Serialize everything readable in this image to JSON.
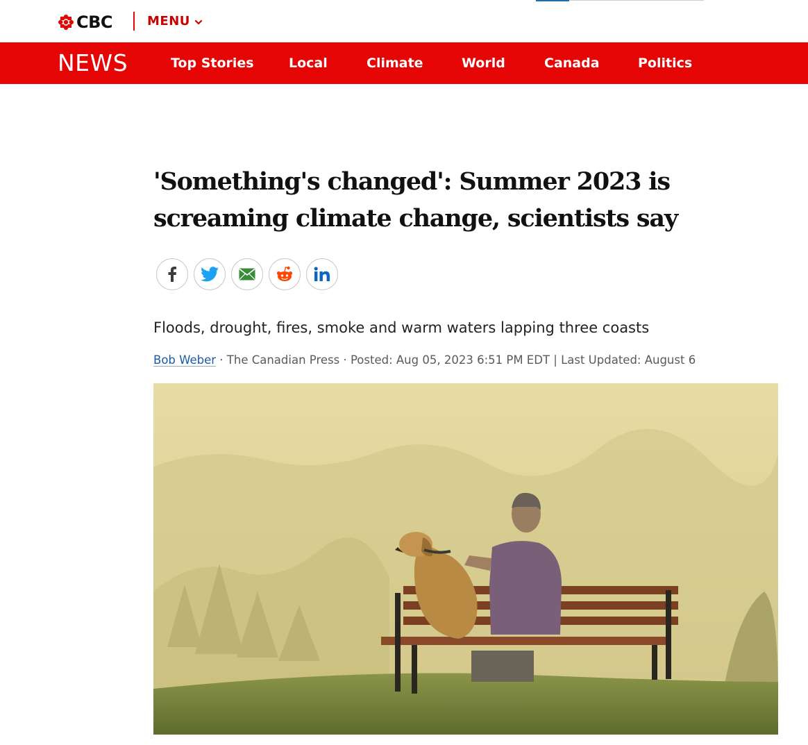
{
  "header": {
    "logo_text": "CBC",
    "menu_label": "MENU",
    "icons": [
      "cbc-gem-icon",
      "chevron-down-icon"
    ]
  },
  "nav": {
    "section": "NEWS",
    "items": [
      {
        "label": "Top Stories"
      },
      {
        "label": "Local"
      },
      {
        "label": "Climate"
      },
      {
        "label": "World"
      },
      {
        "label": "Canada"
      },
      {
        "label": "Politics"
      }
    ]
  },
  "article": {
    "headline": "'Something's changed': Summer 2023 is screaming climate change, scientists say",
    "share_icons": [
      "facebook-icon",
      "twitter-icon",
      "email-icon",
      "reddit-icon",
      "linkedin-icon"
    ],
    "deck": "Floods, drought, fires, smoke and warm waters lapping three coasts",
    "byline": {
      "author": "Bob Weber",
      "source": " · The Canadian Press · Posted: Aug 05, 2023 6:51 PM EDT | Last Updated: August 6"
    }
  },
  "colors": {
    "brand_red": "#e60505",
    "menu_red": "#cc0000",
    "link_blue": "#1a5aa8"
  }
}
